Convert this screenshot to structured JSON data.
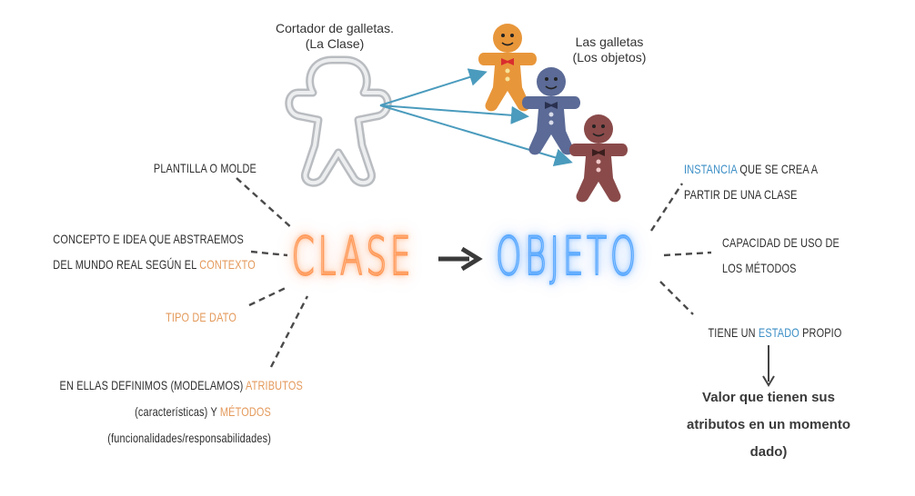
{
  "cutter": {
    "caption_line1": "Cortador de galletas.",
    "caption_line2": "(La Clase)"
  },
  "cookies": {
    "caption_line1": "Las galletas",
    "caption_line2": "(Los objetos)",
    "colors": [
      "#e8963a",
      "#5b6a96",
      "#8a4a4a"
    ]
  },
  "center": {
    "class_word": "CLASE",
    "object_word": "OBJETO",
    "arrow": "arrow-right-icon"
  },
  "left": {
    "item1": "PLANTILLA O MOLDE",
    "item2_line1": "CONCEPTO E IDEA QUE ABSTRAEMOS",
    "item2_line2_pre": "DEL MUNDO REAL SEGÚN EL ",
    "item2_line2_hl": "CONTEXTO",
    "item3": "TIPO DE DATO",
    "item4_line1_pre": "EN ELLAS DEFINIMOS (MODELAMOS) ",
    "item4_line1_hl": "ATRIBUTOS",
    "item4_line2_pre": "(características) Y ",
    "item4_line2_hl": "MÉTODOS",
    "item4_line3": "(funcionalidades/responsabilidades)"
  },
  "right": {
    "item1_line1_hl": "INSTANCIA",
    "item1_line1_post": " QUE SE CREA A",
    "item1_line2": "PARTIR DE UNA CLASE",
    "item2_line1": "CAPACIDAD DE USO DE",
    "item2_line2": "LOS MÉTODOS",
    "item3_pre": "TIENE UN ",
    "item3_hl": "ESTADO",
    "item3_post": " PROPIO",
    "note_line1": "Valor que tienen sus",
    "note_line2": "atributos en un momento",
    "note_line3": "dado)"
  },
  "colors": {
    "accent_orange": "#e49a5c",
    "accent_blue": "#3d8fc6",
    "connector": "#4a9bbd"
  }
}
